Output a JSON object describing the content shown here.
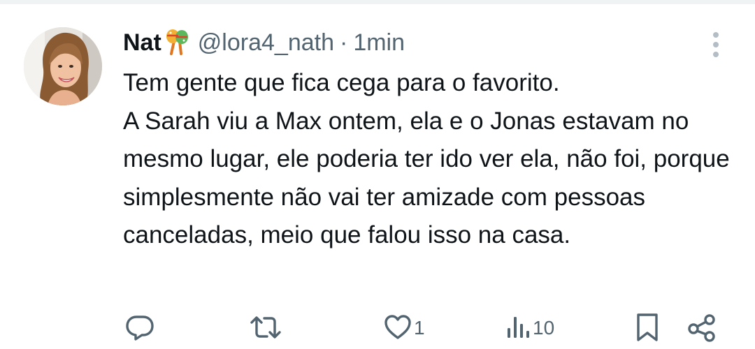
{
  "tweet": {
    "display_name": "Nat",
    "name_emoji": "maracas-emoji",
    "handle": "@lora4_nath",
    "separator": "·",
    "time": "1min",
    "text": "Tem gente que fica cega para o favorito.\nA Sarah viu a Max ontem, ela e o Jonas estavam no mesmo lugar, ele poderia ter ido ver ela, não foi, porque simplesmente não vai ter amizade com pessoas canceladas, meio que falou isso na casa."
  },
  "actions": {
    "reply": {
      "icon": "reply-icon",
      "count": ""
    },
    "retweet": {
      "icon": "retweet-icon",
      "count": ""
    },
    "like": {
      "icon": "heart-icon",
      "count": "1"
    },
    "views": {
      "icon": "views-icon",
      "count": "10"
    },
    "bookmark": {
      "icon": "bookmark-icon"
    },
    "share": {
      "icon": "share-icon"
    }
  },
  "colors": {
    "text": "#0f1419",
    "secondary": "#536471",
    "divider": "#eff3f4",
    "background": "#ffffff"
  }
}
